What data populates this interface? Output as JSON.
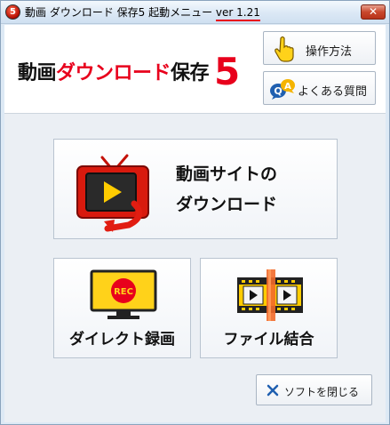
{
  "window": {
    "title_main": "動画 ダウンロード 保存5 起動メニュー",
    "title_version": "ver 1.21",
    "app_icon_glyph": "5",
    "close_glyph": "✕"
  },
  "header": {
    "title_black_1": "動画",
    "title_red": "ダウンロード",
    "title_black_2": "保存",
    "title_number": "5"
  },
  "buttons": {
    "howto_label": "操作方法",
    "faq_label": "よくある質問",
    "site_download_line1": "動画サイトの",
    "site_download_line2": "ダウンロード",
    "direct_record_label": "ダイレクト録画",
    "file_join_label": "ファイル結合",
    "rec_badge": "REC",
    "faq_badge_q": "Q",
    "faq_badge_a": "A",
    "close_glyph": "✕",
    "close_soft_label": "ソフトを閉じる"
  },
  "colors": {
    "accent_red": "#e8001c",
    "tv_red": "#d81a0e",
    "monitor_yellow": "#ffd21a",
    "play_yellow": "#ffcc00",
    "close_blue": "#1f5fb0"
  }
}
